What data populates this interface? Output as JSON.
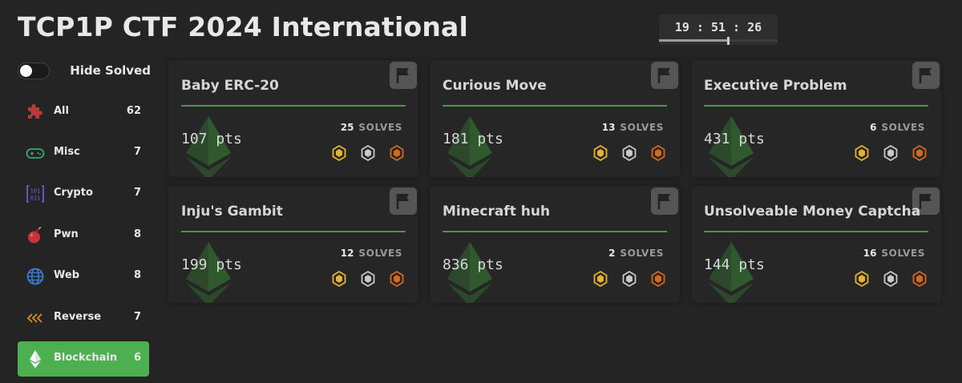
{
  "title": "TCP1P CTF 2024 International",
  "timer": {
    "text": "19 : 51 : 26",
    "progress": 0.58
  },
  "sidebar": {
    "toggle_label": "Hide Solved",
    "toggle_on": false,
    "categories": [
      {
        "label": "All",
        "count": "62",
        "icon": "puzzle-icon",
        "active": false
      },
      {
        "label": "Misc",
        "count": "7",
        "icon": "gamepad-icon",
        "active": false
      },
      {
        "label": "Crypto",
        "count": "7",
        "icon": "binary-icon",
        "active": false
      },
      {
        "label": "Pwn",
        "count": "8",
        "icon": "bomb-icon",
        "active": false
      },
      {
        "label": "Web",
        "count": "8",
        "icon": "globe-icon",
        "active": false
      },
      {
        "label": "Reverse",
        "count": "7",
        "icon": "rewind-icon",
        "active": false
      },
      {
        "label": "Blockchain",
        "count": "6",
        "icon": "ethereum-icon",
        "active": true
      }
    ]
  },
  "challenges": [
    {
      "name": "Baby ERC-20",
      "points": "107 pts",
      "solves": "25",
      "solves_label": "SOLVES"
    },
    {
      "name": "Curious Move",
      "points": "181 pts",
      "solves": "13",
      "solves_label": "SOLVES"
    },
    {
      "name": "Executive Problem",
      "points": "431 pts",
      "solves": "6",
      "solves_label": "SOLVES"
    },
    {
      "name": "Inju's Gambit",
      "points": "199 pts",
      "solves": "12",
      "solves_label": "SOLVES"
    },
    {
      "name": "Minecraft huh",
      "points": "836 pts",
      "solves": "2",
      "solves_label": "SOLVES"
    },
    {
      "name": "Unsolveable Money Captcha",
      "points": "144 pts",
      "solves": "16",
      "solves_label": "SOLVES"
    }
  ],
  "colors": {
    "accent": "#4caf50",
    "rule": "#47964a",
    "gold": "#e6b32e",
    "silver": "#c8c8c8",
    "bronze": "#d2691e"
  }
}
